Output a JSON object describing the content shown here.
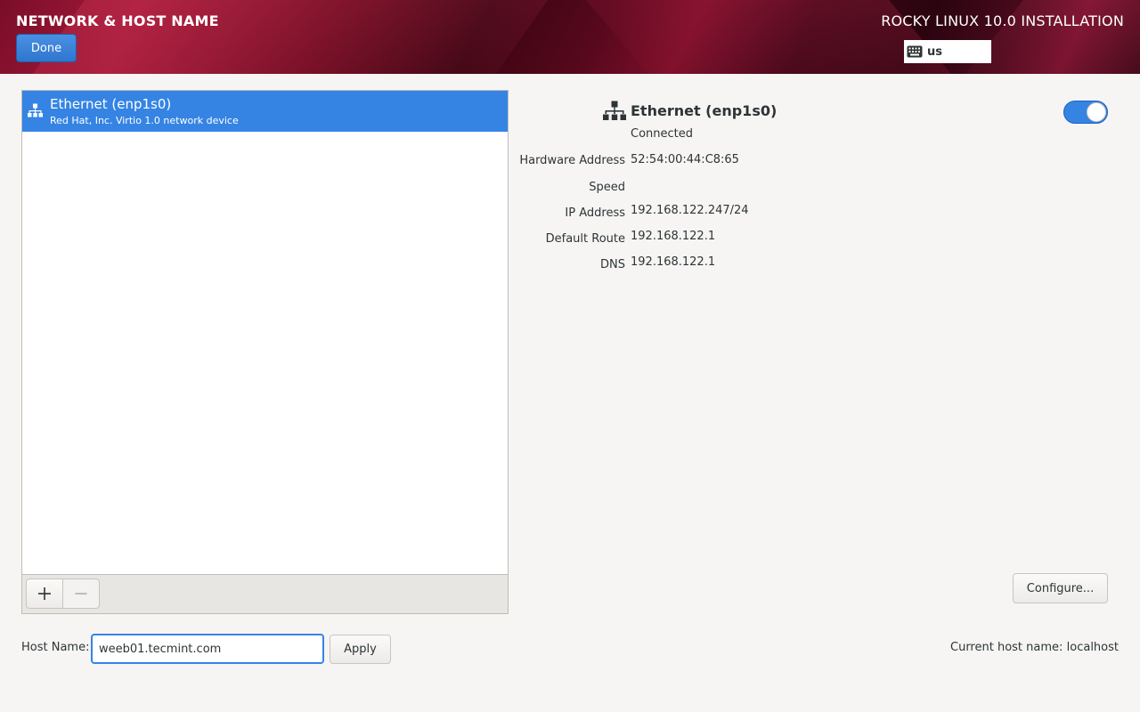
{
  "header": {
    "title": "NETWORK & HOST NAME",
    "done_label": "Done",
    "product": "ROCKY LINUX 10.0 INSTALLATION",
    "keyboard_layout": "us",
    "keyboard_icon": "keyboard-icon"
  },
  "devices": [
    {
      "name": "Ethernet (enp1s0)",
      "description": "Red Hat, Inc. Virtio 1.0 network device",
      "icon": "network-wired-icon",
      "selected": true
    }
  ],
  "toolbar": {
    "add_icon": "plus-icon",
    "remove_icon": "minus-icon"
  },
  "details": {
    "name": "Ethernet (enp1s0)",
    "status": "Connected",
    "enabled": true,
    "properties": [
      {
        "label": "Hardware Address",
        "value": "52:54:00:44:C8:65"
      },
      {
        "label": "Speed",
        "value": ""
      },
      {
        "label": "IP Address",
        "value": "192.168.122.247/24"
      },
      {
        "label": "Default Route",
        "value": "192.168.122.1"
      },
      {
        "label": "DNS",
        "value": "192.168.122.1"
      }
    ],
    "configure_label": "Configure..."
  },
  "hostname": {
    "label": "Host Name:",
    "value": "weeb01.tecmint.com",
    "apply_label": "Apply",
    "current_label": "Current host name:",
    "current_value": "localhost"
  },
  "colors": {
    "accent": "#3584e4",
    "header_dark": "#3a0512",
    "header_red": "#a31a3b"
  }
}
